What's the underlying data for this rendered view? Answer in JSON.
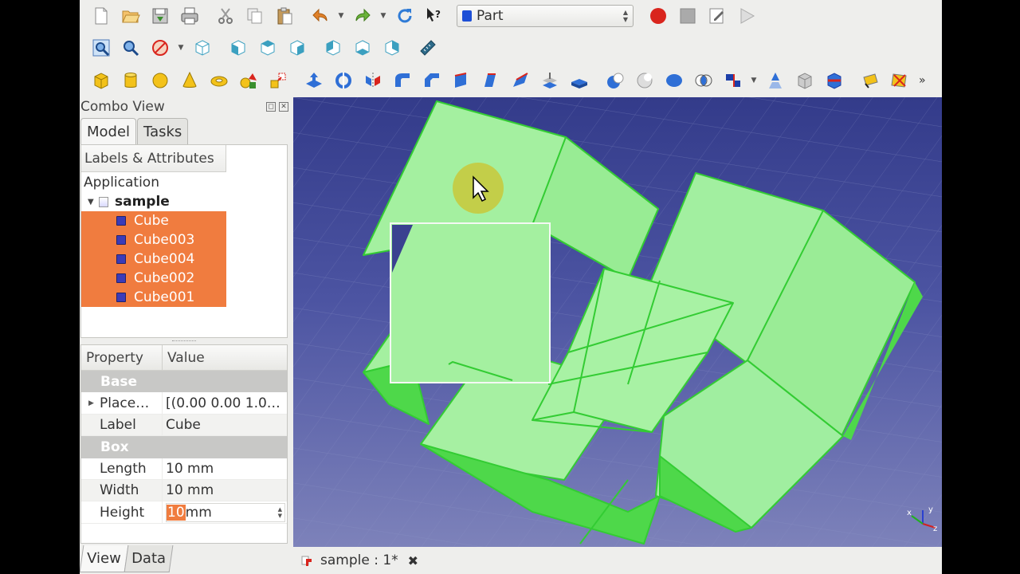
{
  "workbench": {
    "selected": "Part"
  },
  "combo": {
    "title": "Combo View",
    "tabs": [
      "Model",
      "Tasks"
    ]
  },
  "tree": {
    "header": "Labels & Attributes",
    "application": "Application",
    "document": "sample",
    "items": [
      "Cube",
      "Cube003",
      "Cube004",
      "Cube002",
      "Cube001"
    ]
  },
  "properties": {
    "col_property": "Property",
    "col_value": "Value",
    "group_base": "Base",
    "placement_label": "Place…",
    "placement_value": "[(0.00 0.00 1.0…",
    "label_label": "Label",
    "label_value": "Cube",
    "group_box": "Box",
    "length_label": "Length",
    "length_value": "10 mm",
    "width_label": "Width",
    "width_value": "10 mm",
    "height_label": "Height",
    "height_value_selected": "10",
    "height_unit": " mm"
  },
  "bottom_tabs": [
    "View",
    "Data"
  ],
  "document_tab": {
    "label": "sample : 1*",
    "close": "✖"
  },
  "axis": {
    "x": "x",
    "y": "y",
    "z": "z"
  },
  "colors": {
    "selection": "#f07c3f",
    "shape_face": "#a4f0a0",
    "shape_edge": "#33cc33"
  }
}
